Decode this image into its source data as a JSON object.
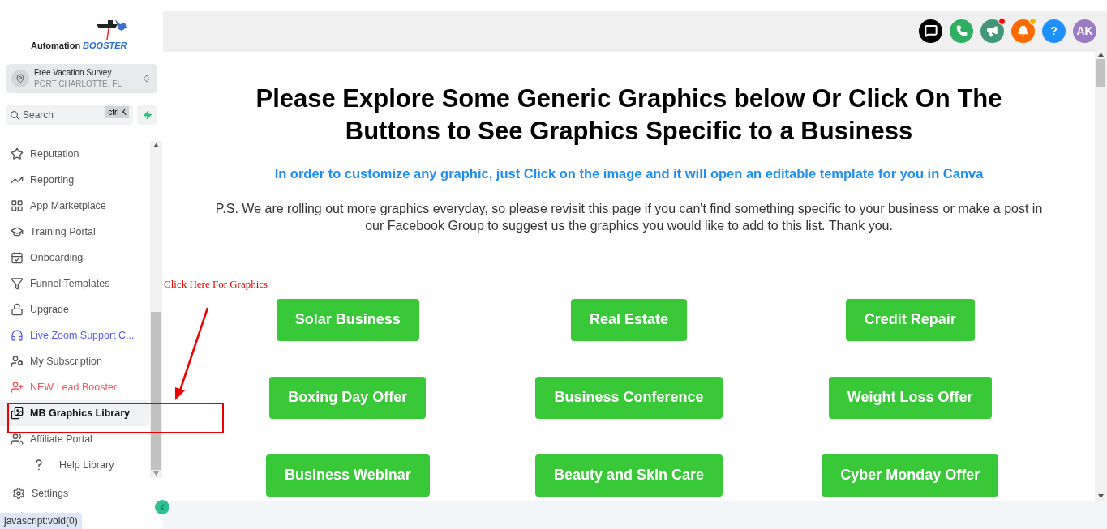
{
  "logo": {
    "word_1": "Automation",
    "word_2": "BOOSTER"
  },
  "account": {
    "name": "Free Vacation Survey",
    "location": "PORT CHARLOTTE, FL"
  },
  "search": {
    "placeholder": "Search",
    "shortcut": "ctrl K"
  },
  "sidebar": {
    "items": [
      {
        "label": "Reputation",
        "color": "#555555",
        "selected": false
      },
      {
        "label": "Reporting",
        "color": "#555555",
        "selected": false
      },
      {
        "label": "App Marketplace",
        "color": "#555555",
        "selected": false
      },
      {
        "label": "Training Portal",
        "color": "#555555",
        "selected": false
      },
      {
        "label": "Onboarding",
        "color": "#555555",
        "selected": false
      },
      {
        "label": "Funnel Templates",
        "color": "#555555",
        "selected": false
      },
      {
        "label": "Upgrade",
        "color": "#555555",
        "selected": false
      },
      {
        "label": "Live Zoom Support C...",
        "color": "#5b5bf5",
        "selected": false
      },
      {
        "label": "My Subscription",
        "color": "#555555",
        "selected": false
      },
      {
        "label": "NEW Lead Booster",
        "color": "#f0555a",
        "selected": false
      },
      {
        "label": "MB Graphics Library",
        "color": "#111111",
        "selected": true
      },
      {
        "label": "Affiliate Portal",
        "color": "#555555",
        "selected": false
      },
      {
        "label": "Help Library",
        "color": "#555555",
        "selected": false
      }
    ],
    "settings": "Settings"
  },
  "status_url": "javascript:void(0)",
  "header_icons": [
    {
      "kind": "chat",
      "color": "#000000",
      "dot": false
    },
    {
      "kind": "phone",
      "color": "#2eaf62",
      "dot": false
    },
    {
      "kind": "megaphone",
      "color": "#42977a",
      "dot": true
    },
    {
      "kind": "bell",
      "color": "#ff6a00",
      "dot": true
    },
    {
      "kind": "help",
      "color": "#1e90ff",
      "dot": false,
      "text": "?"
    },
    {
      "kind": "avatar",
      "color": "#9b7bc4",
      "dot": false,
      "text": "AK"
    }
  ],
  "content": {
    "heading": "Please Explore Some Generic Graphics below Or Click On The Buttons to See Graphics Specific to a Business",
    "subheading": "In order to customize any graphic, just Click on the image and it will open an editable template for you in Canva",
    "note": "P.S. We are rolling out more graphics everyday, so please revisit this page if you can't find something specific to your business or make a post in our Facebook Group to suggest us the graphics you would like to add to this list. Thank you.",
    "buttons": [
      "Solar Business",
      "Real Estate",
      "Credit Repair",
      "Boxing Day Offer",
      "Business Conference",
      "Weight Loss Offer",
      "Business Webinar",
      "Beauty and Skin Care",
      "Cyber Monday Offer"
    ]
  },
  "annotation": {
    "text": "Click Here For Graphics"
  }
}
